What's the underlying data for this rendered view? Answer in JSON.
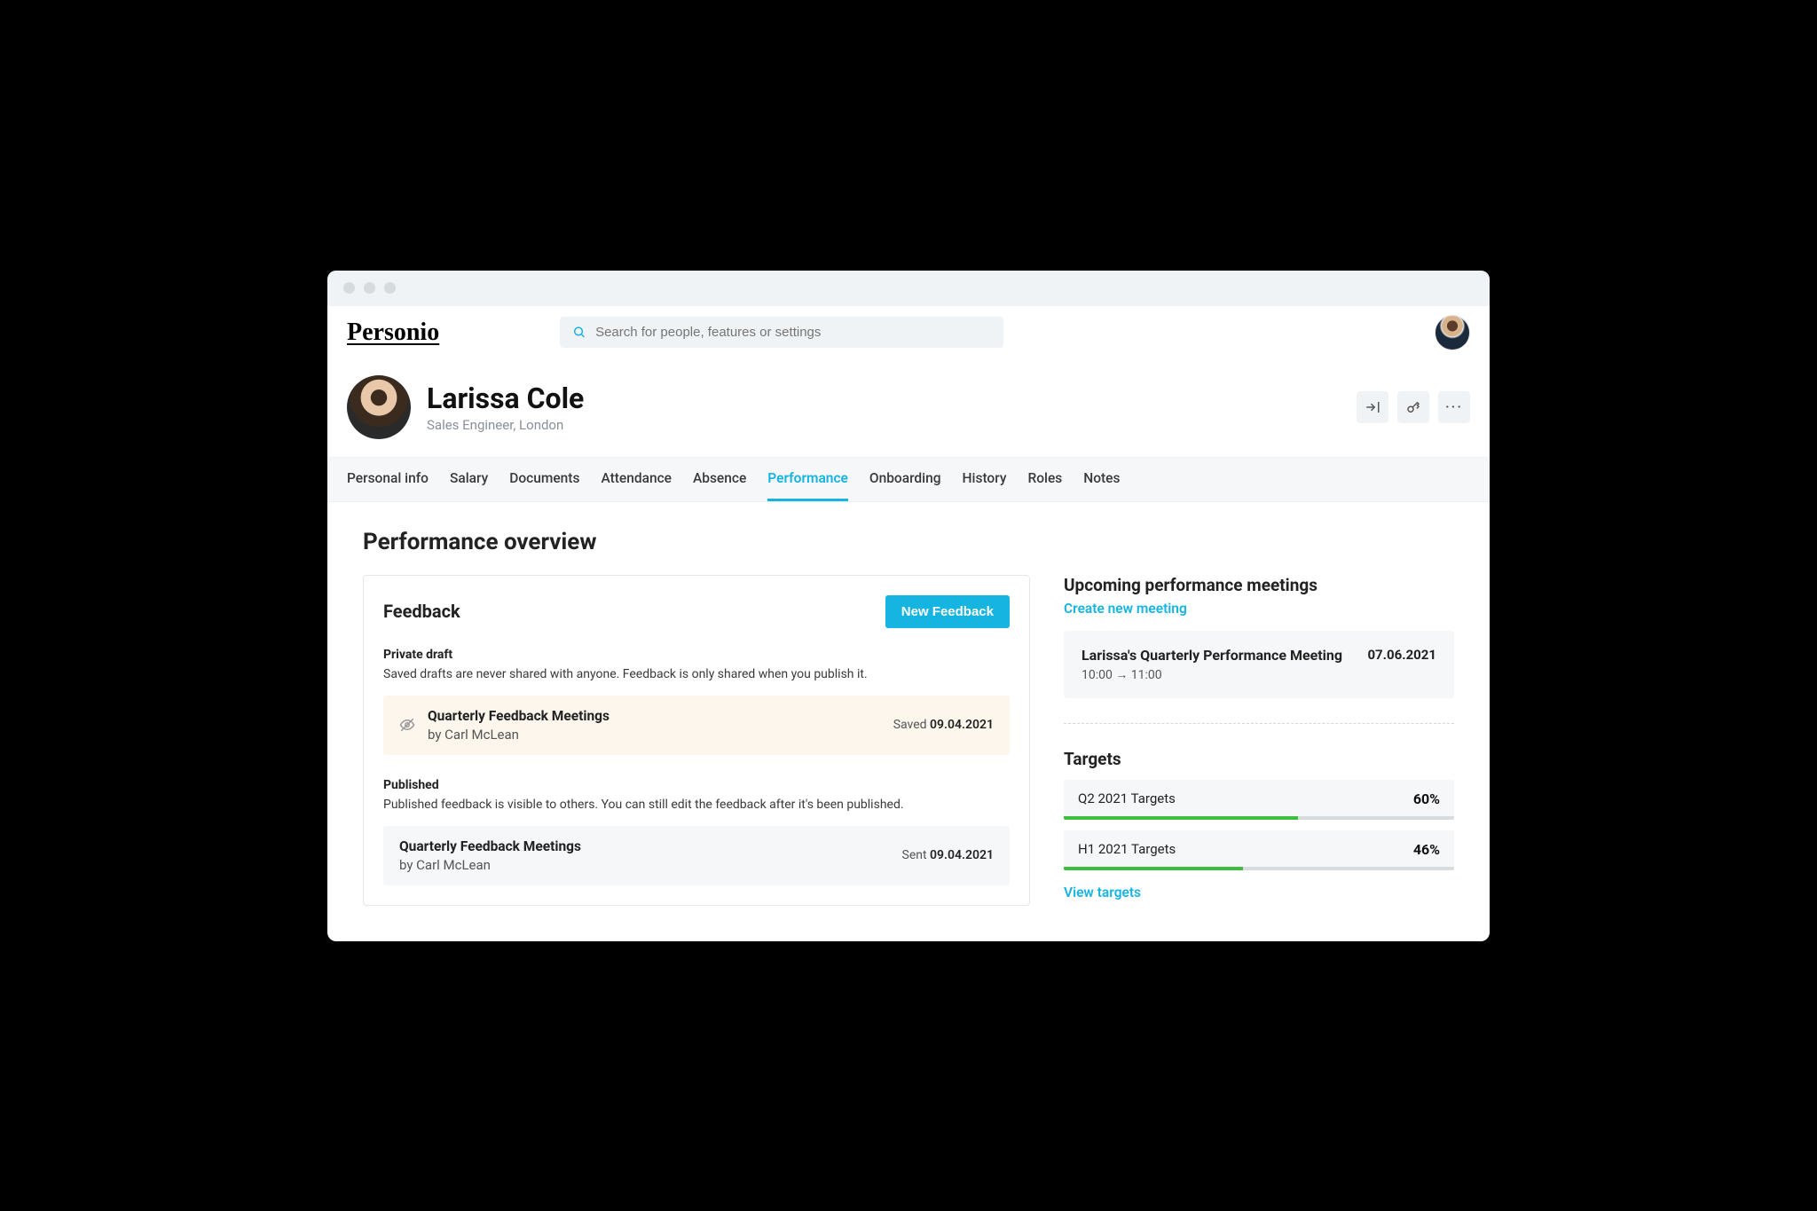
{
  "logo": "Personio",
  "search": {
    "placeholder": "Search for people, features or settings"
  },
  "profile": {
    "name": "Larissa Cole",
    "role": "Sales Engineer, London"
  },
  "tabs": [
    {
      "label": "Personal info",
      "active": false
    },
    {
      "label": "Salary",
      "active": false
    },
    {
      "label": "Documents",
      "active": false
    },
    {
      "label": "Attendance",
      "active": false
    },
    {
      "label": "Absence",
      "active": false
    },
    {
      "label": "Performance",
      "active": true
    },
    {
      "label": "Onboarding",
      "active": false
    },
    {
      "label": "History",
      "active": false
    },
    {
      "label": "Roles",
      "active": false
    },
    {
      "label": "Notes",
      "active": false
    }
  ],
  "page_title": "Performance overview",
  "feedback": {
    "title": "Feedback",
    "button": "New Feedback",
    "draft_label": "Private draft",
    "draft_desc": "Saved drafts are never shared with anyone. Feedback is only shared when you publish it.",
    "draft_item": {
      "title": "Quarterly Feedback Meetings",
      "by": "by Carl McLean",
      "status": "Saved",
      "date": "09.04.2021"
    },
    "pub_label": "Published",
    "pub_desc": "Published feedback is visible to others. You can still edit the feedback after it's been published.",
    "pub_item": {
      "title": "Quarterly Feedback Meetings",
      "by": "by Carl McLean",
      "status": "Sent",
      "date": "09.04.2021"
    }
  },
  "meetings": {
    "title": "Upcoming performance meetings",
    "create": "Create new meeting",
    "item": {
      "title": "Larissa's Quarterly Performance Meeting",
      "time": "10:00 → 11:00",
      "date": "07.06.2021"
    }
  },
  "targets": {
    "title": "Targets",
    "items": [
      {
        "label": "Q2 2021 Targets",
        "pct": "60%",
        "width": 60
      },
      {
        "label": "H1 2021 Targets",
        "pct": "46%",
        "width": 46
      }
    ],
    "view": "View targets"
  }
}
